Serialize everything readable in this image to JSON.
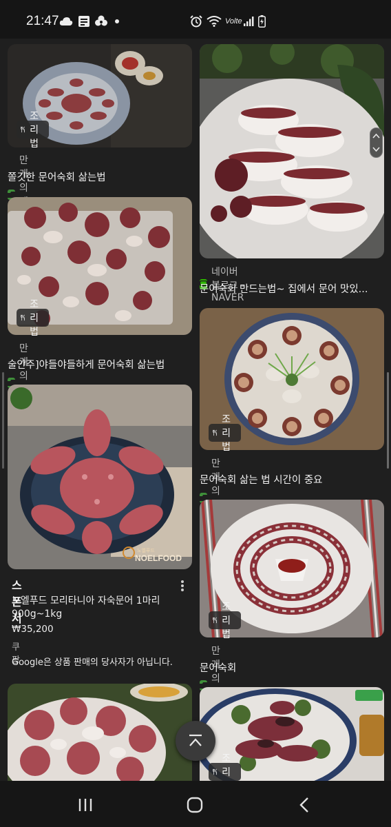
{
  "status_bar": {
    "time": "21:47",
    "network_label": "Volte",
    "icons": [
      "cloud-icon",
      "news-app-icon",
      "clover-app-icon",
      "dot-icon",
      "alarm-icon",
      "wifi-icon",
      "signal-icon",
      "battery-icon"
    ]
  },
  "results": [
    {
      "id": "r1",
      "badge": "조리법",
      "source": "만개의레시피",
      "title": "쫄깃한 문어숙회 삶는법"
    },
    {
      "id": "r2",
      "badge": "",
      "source": "네이버 블로그 - NAVER",
      "title": "문어숙회 만드는법~ 집에서 문어 맛있..."
    },
    {
      "id": "r3",
      "badge": "조리법",
      "source": "만개의레시피",
      "title": "술안주]야들야들하게 문어숙회 삶는법"
    },
    {
      "id": "r4",
      "badge": "조리법",
      "source": "만개의레시피",
      "title": "문어숙회 삶는 법 시간이 중요"
    },
    {
      "id": "r5",
      "badge": "조리법",
      "source": "만개의레시피",
      "title": "문어숙회"
    },
    {
      "id": "r6",
      "badge": "",
      "source": "",
      "title": ""
    },
    {
      "id": "r7",
      "badge": "조리법",
      "source": "",
      "title": ""
    }
  ],
  "ad": {
    "sponsor_label": "스폰서",
    "product_line1": "노엘푸드 모리타니아 자숙문어 1마리",
    "product_line2": "900g~1kg",
    "price": "₩35,200",
    "seller": "쿠팡",
    "disclaimer": "Google은 상품 판매의 당사자가 아닙니다.",
    "watermark_small": "노엘푸드",
    "watermark": "NOELFOOD"
  },
  "colors": {
    "background": "#1f1f1f",
    "recipe_favicon": "#3f8f3a",
    "naver_favicon": "#2db400"
  }
}
